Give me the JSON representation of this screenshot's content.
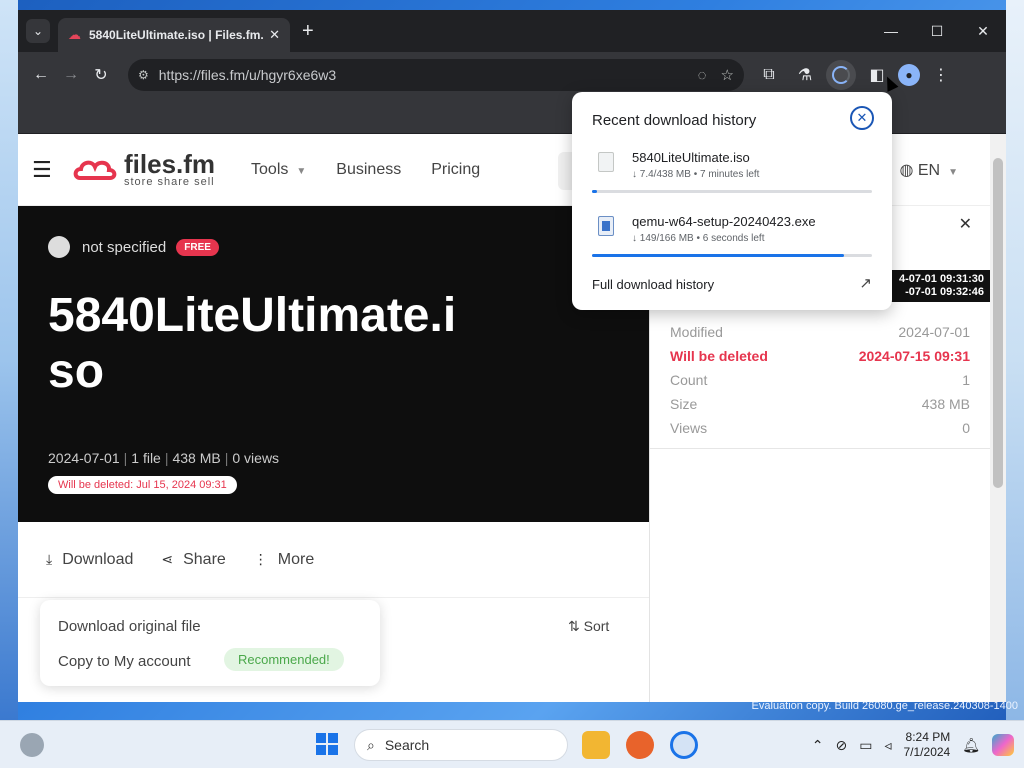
{
  "browser": {
    "tab_title": "5840LiteUltimate.iso | Files.fm.",
    "url": "https://files.fm/u/hgyr6xe6w3"
  },
  "site": {
    "logo_name": "files.fm",
    "logo_tagline": "store share sell",
    "nav": [
      "Tools",
      "Business",
      "Pricing"
    ],
    "language": "EN"
  },
  "hero": {
    "owner": "not specified",
    "badge": "FREE",
    "title": "5840LiteUltimate.iso",
    "meta": [
      "2024-07-01",
      "1 file",
      "438 MB",
      "0 views"
    ],
    "delete_notice": "Will be deleted: Jul 15, 2024 09:31"
  },
  "actions": {
    "download": "Download",
    "share": "Share",
    "more": "More",
    "sort": "Sort"
  },
  "download_menu": {
    "item1": "Download original file",
    "item2": "Copy to My account",
    "recommended": "Recommended!"
  },
  "side": {
    "dates_line1": "4-07-01 09:31:30",
    "dates_line2": "-07-01 09:32:46",
    "rows": [
      {
        "label": "Modified",
        "value": "2024-07-01"
      },
      {
        "label": "Will be deleted",
        "value": "2024-07-15 09:31"
      },
      {
        "label": "Count",
        "value": "1"
      },
      {
        "label": "Size",
        "value": "438 MB"
      },
      {
        "label": "Views",
        "value": "0"
      }
    ]
  },
  "downloads_popup": {
    "heading": "Recent download history",
    "items": [
      {
        "name": "5840LiteUltimate.iso",
        "status": "↓ 7.4/438 MB • 7 minutes left",
        "progress": 0.017
      },
      {
        "name": "qemu-w64-setup-20240423.exe",
        "status": "↓ 149/166 MB • 6 seconds left",
        "progress": 0.9
      }
    ],
    "full_history": "Full download history"
  },
  "taskbar": {
    "search_label": "Search",
    "time": "8:24 PM",
    "date": "7/1/2024",
    "watermark": "Evaluation copy. Build 26080.ge_release.240308-1400"
  }
}
